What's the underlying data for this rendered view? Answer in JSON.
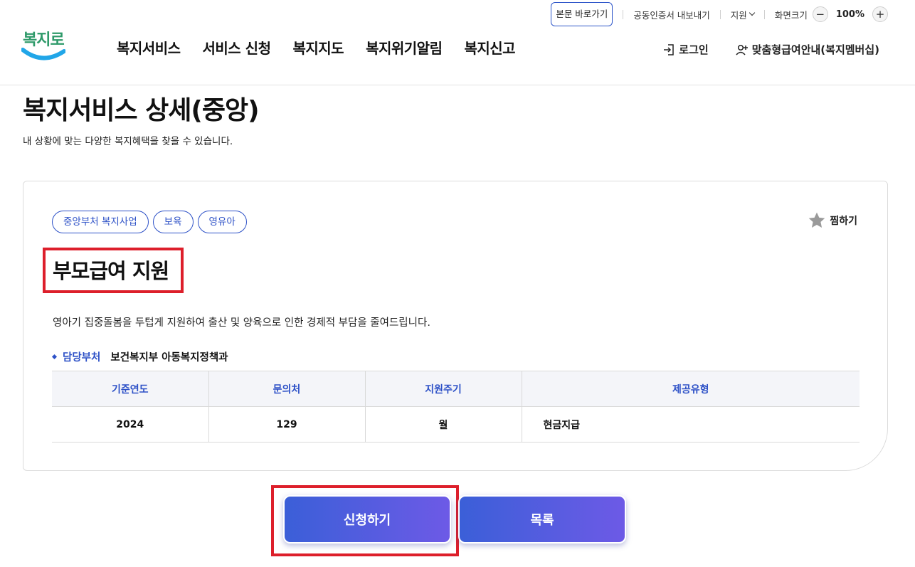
{
  "header": {
    "logo_text": "복지로",
    "utility": {
      "skip_link": "본문 바로가기",
      "cert_export": "공동인증서 내보내기",
      "support": "지원",
      "zoom_label": "화면크기",
      "zoom_value": "100%",
      "zoom_minus": "−",
      "zoom_plus": "+"
    },
    "gnb": [
      "복지서비스",
      "서비스 신청",
      "복지지도",
      "복지위기알림",
      "복지신고"
    ],
    "login": "로그인",
    "membership": "맞춤형급여안내(복지멤버십)"
  },
  "page": {
    "title": "복지서비스 상세(중앙)",
    "description": "내 상황에 맞는 다양한 복지혜택을 찾을 수 있습니다."
  },
  "service": {
    "tags": [
      "중앙부처 복지사업",
      "보육",
      "영유아"
    ],
    "favorite_label": "찜하기",
    "title": "부모급여 지원",
    "description": "영아기 집중돌봄을 두텁게 지원하여 출산 및 양육으로 인한 경제적 부담을 줄여드립니다.",
    "department_label": "담당부처",
    "department_value": "보건복지부 아동복지정책과",
    "table": {
      "headers": [
        "기준연도",
        "문의처",
        "지원주기",
        "제공유형"
      ],
      "row": [
        "2024",
        "129",
        "월",
        "현금지급"
      ]
    }
  },
  "actions": {
    "apply": "신청하기",
    "list": "목록"
  },
  "colors": {
    "accent_blue": "#2d51c7",
    "highlight_red": "#dd1f2b",
    "button_gradient_start": "#3b5fd8",
    "button_gradient_end": "#6d5ae6"
  }
}
